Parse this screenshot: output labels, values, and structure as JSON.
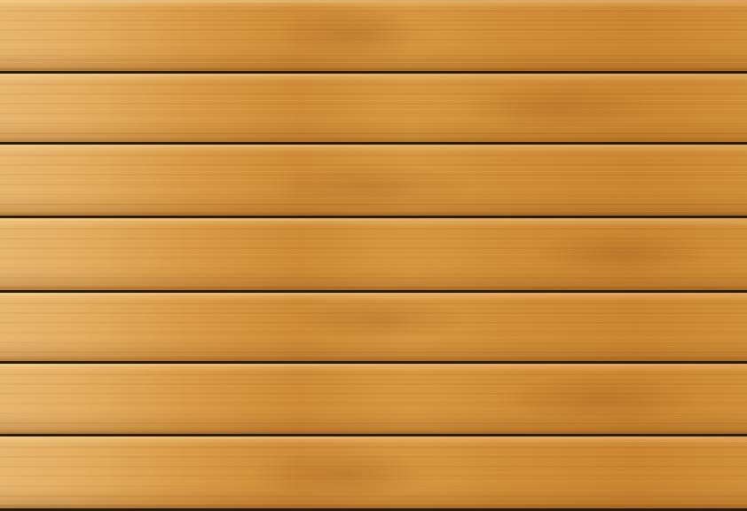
{
  "scene": {
    "subject": "wooden-planks",
    "colors": {
      "wood_light": "#e7b56b",
      "wood_mid": "#d99a45",
      "wood_dark": "#cf8a35",
      "seam": "#2a1c0c"
    }
  }
}
